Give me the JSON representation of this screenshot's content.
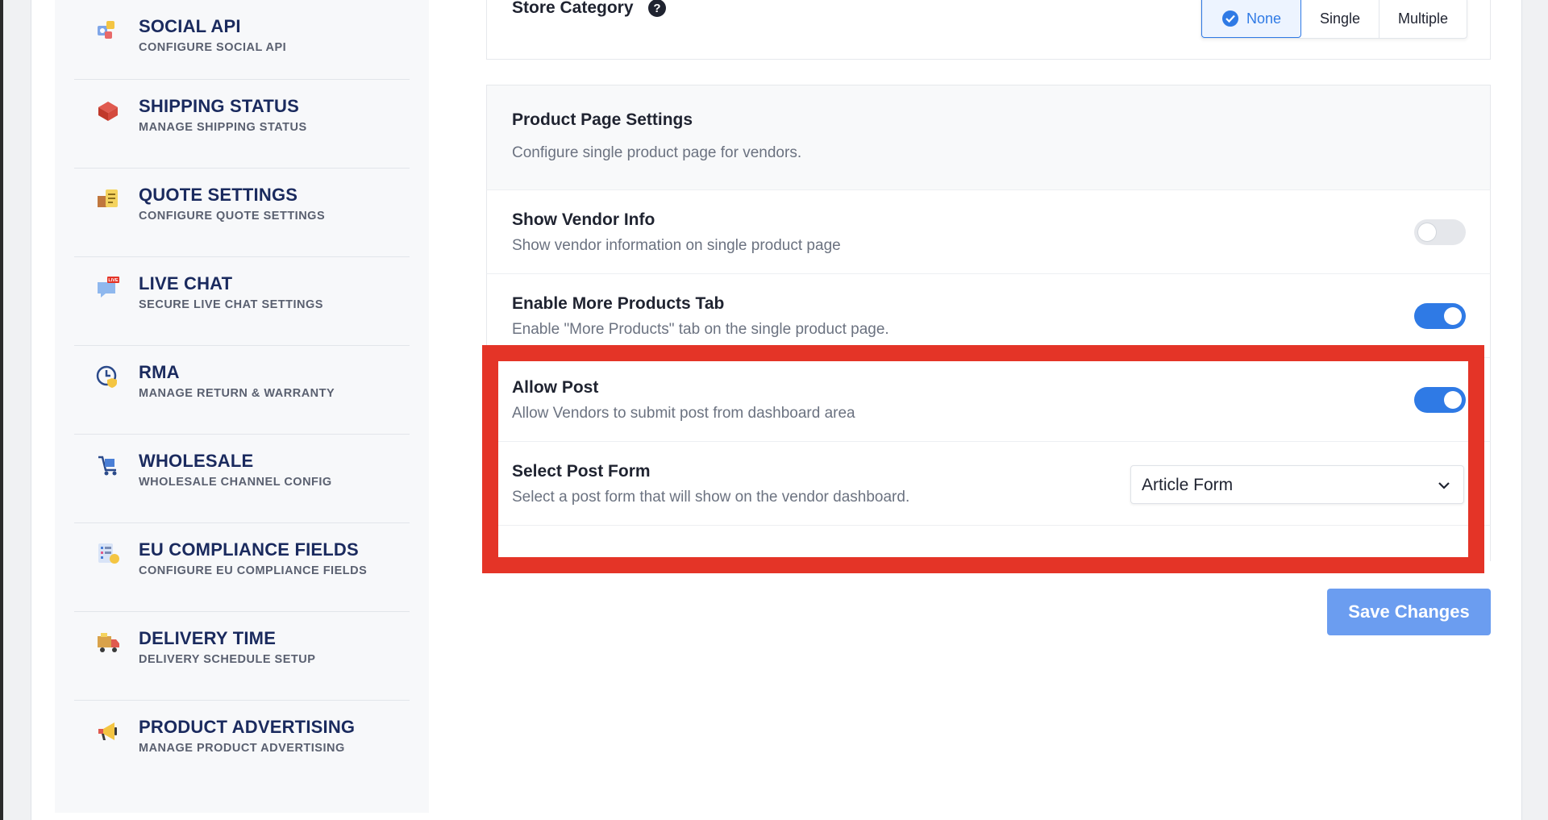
{
  "sidebar": {
    "items": [
      {
        "title": "SOCIAL API",
        "subtitle": "CONFIGURE SOCIAL API",
        "icon": "social-api-icon"
      },
      {
        "title": "SHIPPING STATUS",
        "subtitle": "MANAGE SHIPPING STATUS",
        "icon": "box-icon"
      },
      {
        "title": "QUOTE SETTINGS",
        "subtitle": "CONFIGURE QUOTE SETTINGS",
        "icon": "quote-icon"
      },
      {
        "title": "LIVE CHAT",
        "subtitle": "SECURE LIVE CHAT SETTINGS",
        "icon": "live-chat-icon",
        "badge": "LIVE"
      },
      {
        "title": "RMA",
        "subtitle": "MANAGE RETURN & WARRANTY",
        "icon": "clock-shield-icon"
      },
      {
        "title": "WHOLESALE",
        "subtitle": "WHOLESALE CHANNEL CONFIG",
        "icon": "cart-icon"
      },
      {
        "title": "EU COMPLIANCE FIELDS",
        "subtitle": "CONFIGURE EU COMPLIANCE FIELDS",
        "icon": "compliance-icon"
      },
      {
        "title": "DELIVERY TIME",
        "subtitle": "DELIVERY SCHEDULE SETUP",
        "icon": "delivery-truck-icon"
      },
      {
        "title": "PRODUCT ADVERTISING",
        "subtitle": "MANAGE PRODUCT ADVERTISING",
        "icon": "megaphone-icon"
      }
    ]
  },
  "store_category": {
    "label": "Store Category",
    "help_icon": "question-circle-icon",
    "options": [
      "None",
      "Single",
      "Multiple"
    ],
    "selected": "None"
  },
  "product_page": {
    "title": "Product Page Settings",
    "description": "Configure single product page for vendors."
  },
  "settings": {
    "show_vendor_info": {
      "label": "Show Vendor Info",
      "description": "Show vendor information on single product page",
      "enabled": false
    },
    "more_products_tab": {
      "label": "Enable More Products Tab",
      "description": "Enable \"More Products\" tab on the single product page.",
      "enabled": true
    },
    "allow_post": {
      "label": "Allow Post",
      "description": "Allow Vendors to submit post from dashboard area",
      "enabled": true
    },
    "select_post_form": {
      "label": "Select Post Form",
      "description": "Select a post form that will show on the vendor dashboard.",
      "value": "Article Form"
    }
  },
  "save_label": "Save Changes",
  "colors": {
    "accent": "#2f7ae5",
    "highlight": "#e43427",
    "sidebar_title": "#1a2a5e",
    "save_button": "#6b9df0"
  }
}
